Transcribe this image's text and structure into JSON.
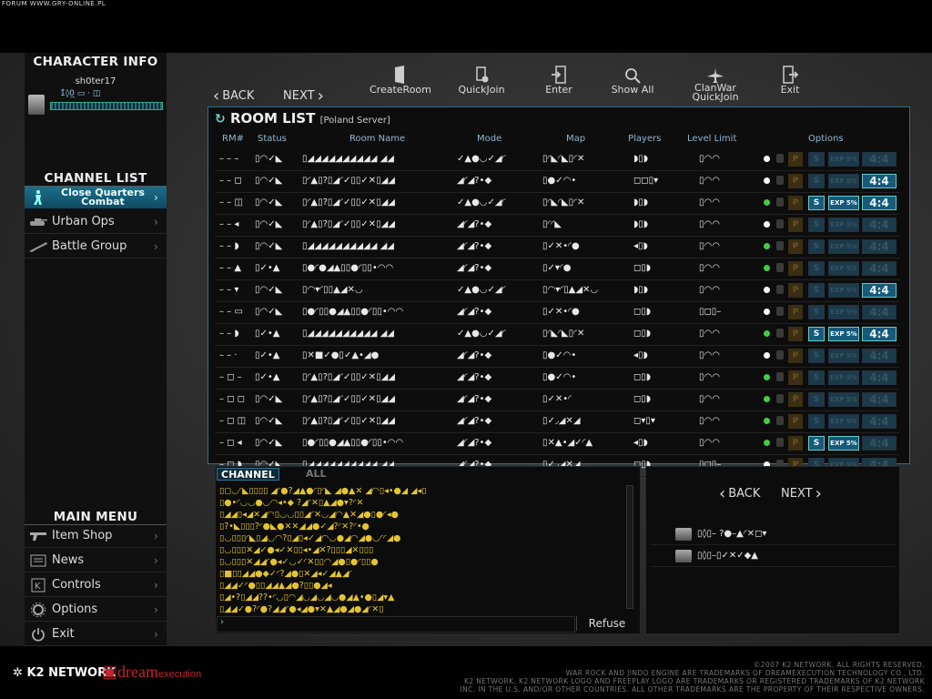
{
  "forum_watermark": "FORUM WWW.GRY-ONLINE.PL",
  "character": {
    "title": "CHARACTER INFO",
    "name": "sh0ter17",
    "stats": "1̂◊0̲ ▭ · ◫"
  },
  "channels": {
    "title": "CHANNEL LIST",
    "items": [
      {
        "label": "Close Quarters Combat",
        "active": true
      },
      {
        "label": "Urban Ops",
        "active": false
      },
      {
        "label": "Battle Group",
        "active": false
      }
    ]
  },
  "main_menu": {
    "title": "MAIN MENU",
    "items": [
      {
        "label": "Item Shop",
        "icon": "gun-icon"
      },
      {
        "label": "News",
        "icon": "news-icon"
      },
      {
        "label": "Controls",
        "icon": "keyboard-icon"
      },
      {
        "label": "Options",
        "icon": "gear-icon"
      },
      {
        "label": "Exit",
        "icon": "power-icon"
      }
    ]
  },
  "toolbar": {
    "back": "BACK",
    "next": "NEXT",
    "create_room": "CreateRoom",
    "quick_join": "QuickJoin",
    "enter": "Enter",
    "show_all": "Show All",
    "clanwar_1": "ClanWar",
    "clanwar_2": "QuickJoin",
    "exit": "Exit"
  },
  "room_list": {
    "title": "ROOM LIST",
    "server": "[Poland Server]",
    "columns": [
      "RM#",
      "Status",
      "Room Name",
      "Mode",
      "Map",
      "Players",
      "Level Limit",
      "Options"
    ],
    "rows": [
      {
        "rm": "– – –",
        "status": "▯◠✓◣",
        "name": "▯◢◢◢◢◢◢◢◢◢◢ ◢◢",
        "mode": "✓▲●◡✓◢◜",
        "map": "▯◜◣◜◣▯◜✕",
        "players": "◗▯◗",
        "level": "▯◠◠",
        "dot": "#ffffff",
        "s": false,
        "exp": false,
        "n": false
      },
      {
        "rm": "– – ◻",
        "status": "▯◠✓◣",
        "name": "▯◜▲▯?▯◢◜✓▯▯✓✕▯◢◢",
        "mode": "◢◜◢?•◆",
        "map": "▯●✓◠•",
        "players": "◻◻▯▾",
        "level": "▯◠◠",
        "dot": "#ffffff",
        "s": false,
        "exp": false,
        "n": true
      },
      {
        "rm": "– – ◫",
        "status": "▯◠✓◣",
        "name": "▯◜▲▯?▯◢◜✓▯▯✓✕▯◢◢",
        "mode": "✓▲●◡✓◢◜",
        "map": "▯◜◣◜◣▯◜✕",
        "players": "◗▯◗",
        "level": "▯◠◠",
        "dot": "#44cc44",
        "s": true,
        "exp": true,
        "n": true
      },
      {
        "rm": "– – ◂",
        "status": "▯◠✓◣",
        "name": "▯◜▲▯?▯◢◜✓▯▯✓✕▯◢◢",
        "mode": "◢◜◢?•◆",
        "map": "▯◜◜◣",
        "players": "◗▯◗",
        "level": "▯◠◠",
        "dot": "#ffffff",
        "s": false,
        "exp": false,
        "n": false
      },
      {
        "rm": "– – ◗",
        "status": "▯◠✓◣",
        "name": "▯◢◢◢◢◢◢◢◢◢◢ ◢◢",
        "mode": "◢◜◢?•◆",
        "map": "▯✓✕•◜●",
        "players": "◂▯◗",
        "level": "▯◠◠",
        "dot": "#44cc44",
        "s": false,
        "exp": false,
        "n": false
      },
      {
        "rm": "– – ▲",
        "status": "▯✓•▲",
        "name": "▯●◜●◢▲▯▯●◜▯▯•◠◠",
        "mode": "◢◜◢?•◆",
        "map": "▯✓▾◜●",
        "players": "◻▯◗",
        "level": "▯◠◠",
        "dot": "#44cc44",
        "s": false,
        "exp": false,
        "n": false
      },
      {
        "rm": "– – ▾",
        "status": "▯◠✓◣",
        "name": "▯◠▾◜▯▯▲◢✕◡",
        "mode": "✓▲●◡✓◢◜",
        "map": "▯◠▾◜▯▲◢✕◡",
        "players": "◗▯◗",
        "level": "▯◠◠",
        "dot": "#ffffff",
        "s": false,
        "exp": false,
        "n": true
      },
      {
        "rm": "– – ▭",
        "status": "▯◠✓◣",
        "name": "▯●◜▯▯●◢▲▯▯●◜▯▯•◠◠",
        "mode": "◢◜◢?•◆",
        "map": "▯✓✕•◜●",
        "players": "◻▯◗",
        "level": "▯◻▯–",
        "dot": "#ffffff",
        "s": false,
        "exp": false,
        "n": false
      },
      {
        "rm": "– – ◗",
        "status": "▯✓•▲",
        "name": "▯◢◢◢◢◢◢◢◢◢◢ ◢◢",
        "mode": "✓▲●◡✓◢◜",
        "map": "▯◜◣◜◣▯◜✕",
        "players": "◻▯◗",
        "level": "▯◠◠",
        "dot": "#44cc44",
        "s": true,
        "exp": true,
        "n": true
      },
      {
        "rm": "– – ·",
        "status": "▯✓•▲",
        "name": "▯✕■✓●▯✓▲•◢●",
        "mode": "◢◜◢?•◆",
        "map": "▯●✓◠•",
        "players": "◂▯◗",
        "level": "▯◠◠",
        "dot": "#ffffff",
        "s": false,
        "exp": false,
        "n": false
      },
      {
        "rm": "– ◻ –",
        "status": "▯✓•▲",
        "name": "▯◜▲▯?▯◢◜✓▯▯✓✕▯◢◢",
        "mode": "◢◜◢?•◆",
        "map": "▯●✓◠•",
        "players": "◻▯◗",
        "level": "▯◠◠",
        "dot": "#44cc44",
        "s": false,
        "exp": false,
        "n": false
      },
      {
        "rm": "– ◻ ◻",
        "status": "▯◠✓◣",
        "name": "▯◜▲▯?▯◢◜✓▯▯✓✕▯◢◢",
        "mode": "◢◜◢?•◆",
        "map": "▯✓✕•◜",
        "players": "◻▯◗",
        "level": "▯◠◠",
        "dot": "#44cc44",
        "s": false,
        "exp": false,
        "n": false
      },
      {
        "rm": "– ◻ ◫",
        "status": "▯◠✓◣",
        "name": "▯◜▲▯?▯◢◜✓▯▯✓✕▯◢◢",
        "mode": "◢◜◢?•◆",
        "map": "▯✓◞◢✕◢",
        "players": "◻▾▯▾",
        "level": "▯◠◠",
        "dot": "#44cc44",
        "s": false,
        "exp": false,
        "n": false
      },
      {
        "rm": "– ◻ ◂",
        "status": "▯◠✓◣",
        "name": "▯●◜▯▯●◢▲▯▯●◜▯▯•◠◠",
        "mode": "◢◜◢?•◆",
        "map": "▯✕▲•◢✓◜▲",
        "players": "◂▯◗",
        "level": "▯◠◠",
        "dot": "#44cc44",
        "s": true,
        "exp": true,
        "n": false
      },
      {
        "rm": "– ◻ ◗",
        "status": "▯◠✓◣",
        "name": "▯◢◢◢◢◢◢◢◢◢◢ ◢◢",
        "mode": "◢◜◢?•◆",
        "map": "▯✓◞◢✕◢",
        "players": "◻▯◗",
        "level": "▯◻▯–",
        "dot": "#ffffff",
        "s": false,
        "exp": false,
        "n": false
      }
    ],
    "opt_s": "S",
    "opt_exp": "EXP 5%",
    "opt_n": "4:4",
    "opt_p": "P"
  },
  "chat": {
    "tab_channel": "CHANNEL",
    "tab_all": "ALL",
    "lines": [
      "▯◻◡◜◣▯▯▯▯ ◢◜●?◢▲●◜▯◜◣ ◢●▲✕ ◢◠▯◂•●◢ ◢◂▯",
      "▯●•◜◡◡●◡◠◂•◆ ?◢◜✕▯▲◢●▾?◜✕",
      "▯◢◢▯◂◢✕◢◠▯◡◡▯▯◢◜✕◡◢◠▲✕◢●▯●◜◂●",
      "▯?•◣▯▯▯?◜●◣●✕✕◢◢●✓◢?◜✕?◜•●",
      "▯◡▯▯▯◜◣▯◢◡◠?▯◢▯◂✓◢◠◡●◢◠◢●◡◜◜◢●",
      "▯◡▯▯▯✕◢✓●◂✓✕▯▯◂•◢✕?▯▯▯◢✕▯▯▯",
      "▯◡▯▯▯✕◢◢◜●◂✓◡✓◜✕▯▯◠◢●▯●◜▯▯●",
      "▯■▯▯◢◢●◆✓◜?◢●▯✕◢◂✓◢▲◢◜",
      "▯◢◢✓◜●▯▯◢◢▲◢●?▯▯●◢◂",
      "▯◢•?▯◢◢??•◜◡▯◠◢◡◢◡◢◡●◢▲•●▯◢▾▲",
      "▯◢◢✓●?◜●?◢◢◜●◂◢●▾✕▲◢●◢●◢◜✕▯"
    ],
    "input_prompt": "›",
    "refuse": "Refuse"
  },
  "mini_panel": {
    "back": "BACK",
    "next": "NEXT",
    "users": [
      {
        "name": "▯◊▯– ?●–▲◜✕◻▾"
      },
      {
        "name": "▯◊▯–▯✓✕✓◆▲"
      }
    ]
  },
  "footer": {
    "k2": "K2 NETWORK",
    "dream": "dream",
    "dream_suffix": "execution",
    "legal_1": "©2007 K2 NETWORK. ALL RIGHTS RESERVED.",
    "legal_2": "WAR ROCK AND JINDO ENGINE ARE TRADEMARKS OF DREAMEXECUTION TECHNOLOGY CO., LTD.",
    "legal_3": "K2 NETWORK, K2 NETWORK LOGO AND FREEPLAY LOGO ARE TRADEMARKS OR REGISTERED TRADEMARKS OF K2 NETWORK",
    "legal_4": "INC. IN THE U.S. AND/OR OTHER COUNTRIES. ALL OTHER TRADEMARKS ARE THE PROPERTY OF THEIR RESPECTIVE OWNERS."
  },
  "colors": {
    "accent": "#2b7a9a",
    "chat_text": "#e3c430",
    "online_dot": "#44cc44",
    "brand_red": "#c2262e"
  }
}
